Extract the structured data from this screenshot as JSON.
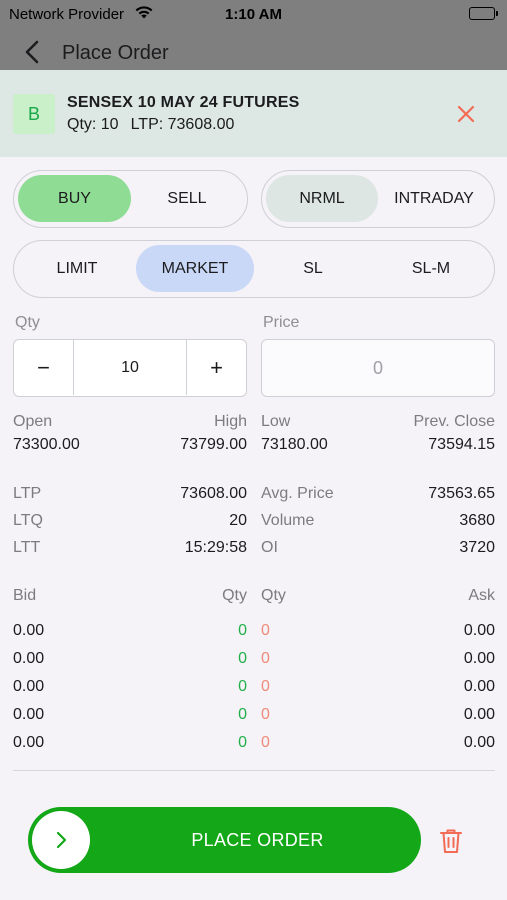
{
  "status_bar": {
    "carrier": "Network Provider",
    "time": "1:10 AM"
  },
  "nav": {
    "title": "Place Order"
  },
  "instrument": {
    "badge": "B",
    "symbol": "SENSEX 10 MAY 24 FUTURES",
    "qty_text": "Qty: 10",
    "ltp_text": "LTP: 73608.00"
  },
  "side_toggle": {
    "options": [
      "BUY",
      "SELL"
    ],
    "selected": "BUY"
  },
  "product_toggle": {
    "options": [
      "NRML",
      "INTRADAY"
    ],
    "selected": "NRML"
  },
  "order_type": {
    "options": [
      "LIMIT",
      "MARKET",
      "SL",
      "SL-M"
    ],
    "selected": "MARKET"
  },
  "qty": {
    "label": "Qty",
    "value": "10",
    "minus": "−",
    "plus": "+"
  },
  "price": {
    "label": "Price",
    "placeholder": "0"
  },
  "ohlc": {
    "open_label": "Open",
    "open": "73300.00",
    "high_label": "High",
    "high": "73799.00",
    "low_label": "Low",
    "low": "73180.00",
    "prev_close_label": "Prev. Close",
    "prev_close": "73594.15"
  },
  "stats": {
    "ltp_label": "LTP",
    "ltp": "73608.00",
    "ltq_label": "LTQ",
    "ltq": "20",
    "ltt_label": "LTT",
    "ltt": "15:29:58",
    "avg_label": "Avg. Price",
    "avg": "73563.65",
    "volume_label": "Volume",
    "volume": "3680",
    "oi_label": "OI",
    "oi": "3720"
  },
  "depth": {
    "headers": {
      "bid": "Bid",
      "bid_qty": "Qty",
      "ask_qty": "Qty",
      "ask": "Ask"
    },
    "rows": [
      {
        "bid": "0.00",
        "bid_qty": "0",
        "ask_qty": "0",
        "ask": "0.00"
      },
      {
        "bid": "0.00",
        "bid_qty": "0",
        "ask_qty": "0",
        "ask": "0.00"
      },
      {
        "bid": "0.00",
        "bid_qty": "0",
        "ask_qty": "0",
        "ask": "0.00"
      },
      {
        "bid": "0.00",
        "bid_qty": "0",
        "ask_qty": "0",
        "ask": "0.00"
      },
      {
        "bid": "0.00",
        "bid_qty": "0",
        "ask_qty": "0",
        "ask": "0.00"
      }
    ]
  },
  "actions": {
    "place_order": "PLACE ORDER"
  },
  "colors": {
    "buy_selected": "#8fdc94",
    "nrml_selected": "#dde6e3",
    "market_selected": "#c9d8f7",
    "place_order_bg": "#14a818",
    "close_icon": "#f26b54",
    "trash_icon": "#f26b54"
  }
}
